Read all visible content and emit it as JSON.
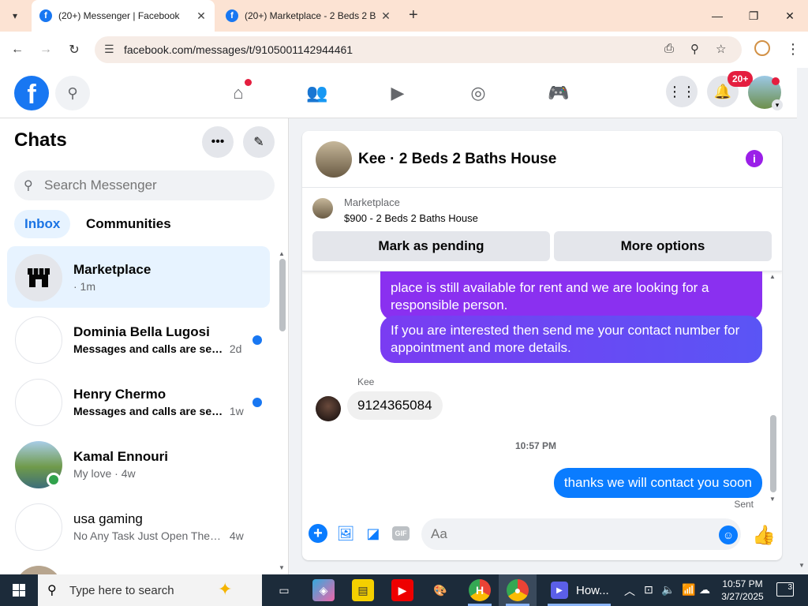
{
  "browser": {
    "tabs": [
      {
        "title": "(20+) Messenger | Facebook",
        "active": true
      },
      {
        "title": "(20+) Marketplace - 2 Beds 2 B",
        "active": false
      }
    ],
    "url": "facebook.com/messages/t/9105001142944461"
  },
  "header": {
    "notification_badge": "20+"
  },
  "sidebar": {
    "title": "Chats",
    "search_placeholder": "Search Messenger",
    "filters": [
      "Inbox",
      "Communities"
    ],
    "chats": [
      {
        "name": "Marketplace",
        "subtitle": "· 1m",
        "message": "",
        "time": "",
        "unread": false,
        "selected": true
      },
      {
        "name": "Dominia Bella Lugosi",
        "message": "Messages and calls are secu...",
        "time": "2d",
        "unread": true
      },
      {
        "name": "Henry Chermo",
        "message": "Messages and calls are sec...",
        "time": "1w",
        "unread": true
      },
      {
        "name": "Kamal Ennouri",
        "message": "My love",
        "time": "4w",
        "unread": false,
        "online": true
      },
      {
        "name": "usa gaming",
        "message": "No Any Task Just Open The lin...",
        "time": "4w",
        "unread": false
      }
    ]
  },
  "conversation": {
    "title": "Kee · 2 Beds 2 Baths House",
    "listing": {
      "label": "Marketplace",
      "title": "$900 - 2 Beds 2 Baths House",
      "buttons": [
        "Mark as pending",
        "More options"
      ]
    },
    "messages": {
      "out_1": "place is still available for rent and we are looking for a responsible person.",
      "out_2": "If you are interested then send me your contact number for appointment and more details.",
      "sender": "Kee",
      "in_1": "9124365084",
      "timestamp": "10:57 PM",
      "out_3": "thanks we will contact you soon",
      "status": "Sent"
    },
    "composer_placeholder": "Aa"
  },
  "taskbar": {
    "search_placeholder": "Type here to search",
    "window_label": "How...",
    "time": "10:57 PM",
    "date": "3/27/2025",
    "notif_count": "3"
  },
  "colors": {
    "fb_blue": "#1877f2",
    "messenger_purple": "#8a30f0",
    "messenger_blue": "#0a7cff",
    "tab_bar": "#fce3d3"
  }
}
